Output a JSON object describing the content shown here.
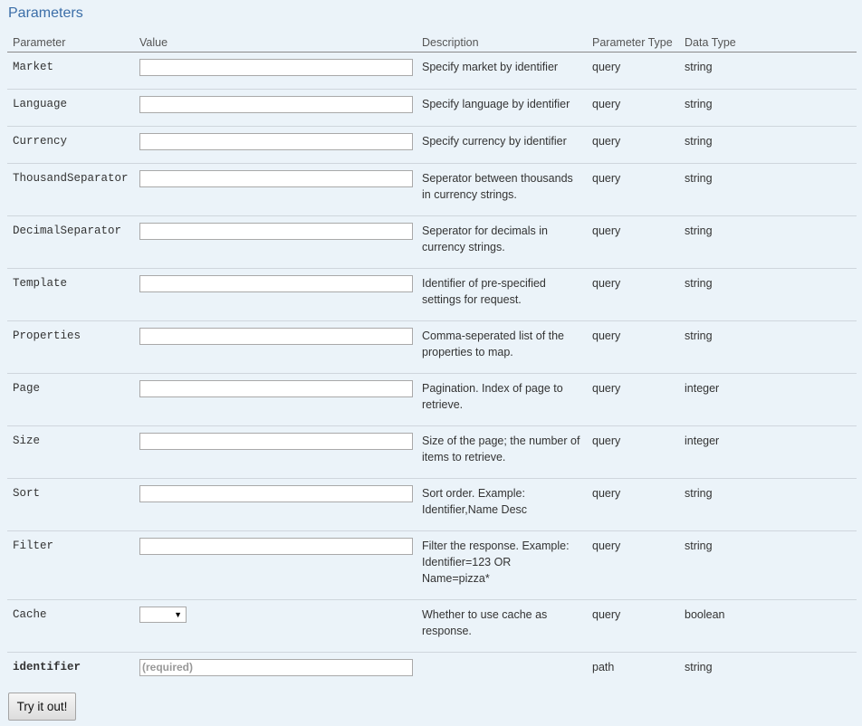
{
  "section": {
    "title": "Parameters"
  },
  "headers": {
    "parameter": "Parameter",
    "value": "Value",
    "description": "Description",
    "param_type": "Parameter Type",
    "data_type": "Data Type"
  },
  "params": [
    {
      "name": "Market",
      "value": "",
      "description": "Specify market by identifier",
      "param_type": "query",
      "data_type": "string"
    },
    {
      "name": "Language",
      "value": "",
      "description": "Specify language by identifier",
      "param_type": "query",
      "data_type": "string"
    },
    {
      "name": "Currency",
      "value": "",
      "description": "Specify currency by identifier",
      "param_type": "query",
      "data_type": "string"
    },
    {
      "name": "ThousandSeparator",
      "value": "",
      "description": "Seperator between thousands in currency strings.",
      "param_type": "query",
      "data_type": "string"
    },
    {
      "name": "DecimalSeparator",
      "value": "",
      "description": "Seperator for decimals in currency strings.",
      "param_type": "query",
      "data_type": "string"
    },
    {
      "name": "Template",
      "value": "",
      "description": "Identifier of pre-specified settings for request.",
      "param_type": "query",
      "data_type": "string"
    },
    {
      "name": "Properties",
      "value": "",
      "description": "Comma-seperated list of the properties to map.",
      "param_type": "query",
      "data_type": "string"
    },
    {
      "name": "Page",
      "value": "",
      "description": "Pagination. Index of page to retrieve.",
      "param_type": "query",
      "data_type": "integer"
    },
    {
      "name": "Size",
      "value": "",
      "description": "Size of the page; the number of items to retrieve.",
      "param_type": "query",
      "data_type": "integer"
    },
    {
      "name": "Sort",
      "value": "",
      "description": "Sort order. Example: Identifier,Name Desc",
      "param_type": "query",
      "data_type": "string"
    },
    {
      "name": "Filter",
      "value": "",
      "description": "Filter the response. Example: Identifier=123 OR Name=pizza*",
      "param_type": "query",
      "data_type": "string"
    },
    {
      "name": "Cache",
      "value": "",
      "description": "Whether to use cache as response.",
      "param_type": "query",
      "data_type": "boolean"
    },
    {
      "name": "identifier",
      "value": "",
      "placeholder": "(required)",
      "description": "",
      "param_type": "path",
      "data_type": "string"
    }
  ],
  "cache_select": {
    "selected": "",
    "arrow_icon": "triangle-down-icon"
  },
  "actions": {
    "try_label": "Try it out!"
  }
}
